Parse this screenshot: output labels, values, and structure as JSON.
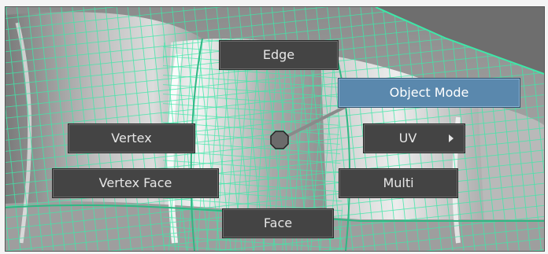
{
  "marking_menu": {
    "north": {
      "label": "Edge"
    },
    "northeast": {
      "label": "Object Mode",
      "active": true
    },
    "west": {
      "label": "Vertex"
    },
    "east": {
      "label": "UV",
      "has_submenu": true
    },
    "southwest": {
      "label": "Vertex Face"
    },
    "southeast": {
      "label": "Multi"
    },
    "south": {
      "label": "Face"
    }
  },
  "colors": {
    "wireframe": "#3de8a8",
    "menu_bg": "#444444",
    "menu_active": "#5a88ad",
    "menu_text": "#e6e6e6",
    "viewport_bg": "#6e6e6e"
  },
  "icons": {
    "center": "menu-center-marker-icon",
    "submenu": "submenu-arrow-icon"
  }
}
